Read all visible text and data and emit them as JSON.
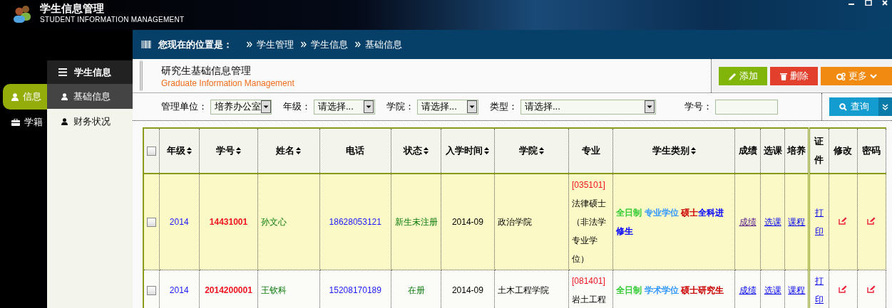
{
  "app": {
    "title": "学生信息管理",
    "subtitle": "STUDENT INFORMATION MANAGEMENT"
  },
  "nav": [
    {
      "label": "信息",
      "selected": true
    },
    {
      "label": "学籍",
      "selected": false
    }
  ],
  "breadcrumb": {
    "label": "您现在的位置是：",
    "items": [
      "学生管理",
      "学生信息",
      "基础信息"
    ]
  },
  "subnav": {
    "title": "学生信息",
    "items": [
      {
        "label": "基础信息",
        "selected": true
      },
      {
        "label": "财务状况",
        "selected": false
      }
    ]
  },
  "page": {
    "title": "研究生基础信息管理",
    "subtitle": "Graduate Information Management"
  },
  "actions": [
    {
      "label": "添加",
      "kind": "add"
    },
    {
      "label": "删除",
      "kind": "delete"
    },
    {
      "label": "更多",
      "kind": "more"
    }
  ],
  "filters": [
    {
      "label": "管理单位：",
      "kind": "select",
      "value": "培养办公室"
    },
    {
      "label": "年级：",
      "kind": "select",
      "value": "请选择..."
    },
    {
      "label": "学院：",
      "kind": "select",
      "value": "请选择..."
    },
    {
      "label": "类型：",
      "kind": "select",
      "value": "请选择..."
    },
    {
      "label": "学号：",
      "kind": "text"
    }
  ],
  "query_button": "查询",
  "table": {
    "select_all_checked": false,
    "columns": [
      {
        "label": "年级",
        "sortable": true
      },
      {
        "label": "学号",
        "sortable": true
      },
      {
        "label": "姓名",
        "sortable": true
      },
      {
        "label": "电话",
        "sortable": false
      },
      {
        "label": "状态",
        "sortable": true
      },
      {
        "label": "入学时间",
        "sortable": true
      },
      {
        "label": "学院",
        "sortable": true
      },
      {
        "label": "专业",
        "sortable": false
      },
      {
        "label": "学生类别",
        "sortable": true
      },
      {
        "label": "成绩",
        "sortable": false
      },
      {
        "label": "选课",
        "sortable": false
      },
      {
        "label": "培养",
        "sortable": false
      },
      {
        "label": "证件",
        "sortable": false
      },
      {
        "label": "修改",
        "sortable": false
      },
      {
        "label": "密码",
        "sortable": false
      }
    ],
    "rows": [
      {
        "selected": true,
        "checked": false,
        "grade": "2014",
        "student_id": "14431001",
        "name": "孙文心",
        "phone": "18628053121",
        "status": "新生未注册",
        "enrolled": "2014-09",
        "college": "政治学院",
        "major_code": "[035101]",
        "major_name": "法律硕士（非法学专业学位）",
        "type_segments": [
          {
            "text": "全日制",
            "color": "#33cc33"
          },
          {
            "text": "专业学位",
            "color": "#3399ff"
          },
          {
            "text": "硕士",
            "color": "#cc0000"
          },
          {
            "text": "全科进修生",
            "color": "#0000ff"
          }
        ],
        "links": [
          {
            "text": "成绩",
            "visited": true
          },
          {
            "text": "选课",
            "visited": false
          },
          {
            "text": "课程",
            "visited": false
          },
          {
            "text": "打印",
            "visited": false
          }
        ]
      },
      {
        "selected": false,
        "checked": false,
        "grade": "2014",
        "student_id": "2014200001",
        "name": "王钦科",
        "phone": "15208170189",
        "status": "在册",
        "enrolled": "2014-09",
        "college": "土木工程学院",
        "major_code": "[081401]",
        "major_name": "岩土工程",
        "type_segments": [
          {
            "text": "全日制",
            "color": "#33cc33"
          },
          {
            "text": "学术学位",
            "color": "#3399ff"
          },
          {
            "text": "硕士研究生",
            "color": "#cc0000"
          }
        ],
        "links": [
          {
            "text": "成绩",
            "visited": false
          },
          {
            "text": "选课",
            "visited": false
          },
          {
            "text": "课程",
            "visited": false
          },
          {
            "text": "打印",
            "visited": false
          }
        ]
      }
    ]
  }
}
